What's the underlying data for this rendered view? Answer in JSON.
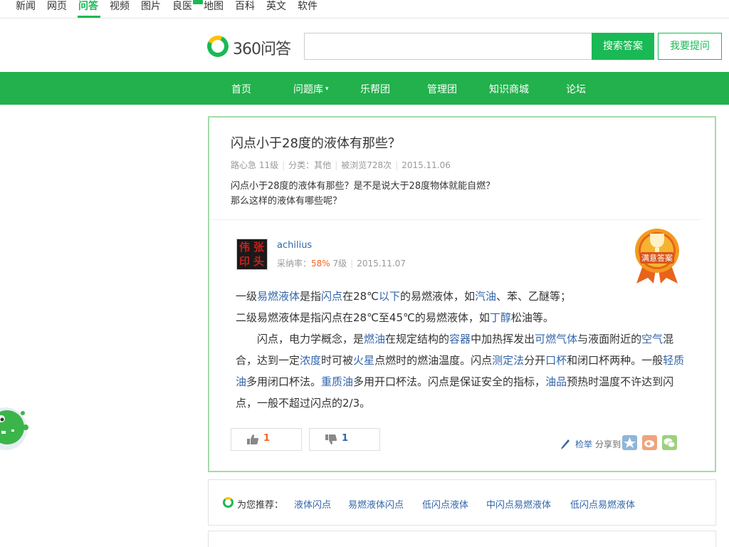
{
  "topnav": {
    "items": [
      {
        "label": "新闻"
      },
      {
        "label": "网页"
      },
      {
        "label": "问答"
      },
      {
        "label": "视频"
      },
      {
        "label": "图片"
      },
      {
        "label": "良医"
      },
      {
        "label": "地图"
      },
      {
        "label": "百科"
      },
      {
        "label": "英文"
      },
      {
        "label": "软件"
      }
    ],
    "active": "问答"
  },
  "header": {
    "logo_text": "360问答",
    "search": {
      "value": "",
      "placeholder": ""
    },
    "search_button": "搜索答案",
    "ask_button": "我要提问"
  },
  "mainnav": {
    "items": [
      {
        "label": "首页"
      },
      {
        "label": "问题库"
      },
      {
        "label": "乐帮团"
      },
      {
        "label": "管理团"
      },
      {
        "label": "知识商城"
      },
      {
        "label": "论坛"
      }
    ]
  },
  "question": {
    "title": "闪点小于28度的液体有那些？",
    "author": "路心急",
    "level": "11级",
    "category": "分类：其他",
    "views": "被浏览728次",
    "date": "2015.11.06",
    "desc_line1": "闪点小于28度的液体有那些？是不是说大于28度物体就能自燃？",
    "desc_line2": "那么这样的液体有哪些呢？"
  },
  "answer": {
    "user": "achilius",
    "accept_label": "采纳率：",
    "accept_rate": "58%",
    "level": "7级",
    "date": "2015.11.07",
    "badge_text": "满意答案",
    "line1": [
      "一级",
      "易燃液体",
      "是指",
      "闪点",
      "在28℃",
      "以下",
      "的易燃液体，如",
      "汽油",
      "、苯、乙醚等；"
    ],
    "line2": [
      "二级易燃液体是指闪点在28℃至45℃的易燃液体，如",
      "丁醇",
      "松油等。"
    ],
    "para2": [
      "闪点，电力学概念，是",
      "燃油",
      "在规定结构的",
      "容器",
      "中加热挥发出",
      "可燃气体",
      "与液面附近的",
      "空气",
      "混合，达到一定",
      "浓度",
      "时可被",
      "火星",
      "点燃时的燃油温度。闪点",
      "测定法",
      "分开",
      "口杯",
      "和闭口杯两种。一般",
      "轻质油",
      "多用闭口杯法。",
      "重质油",
      "多用开口杯法。闪点是保证安全的指标，",
      "油品",
      "预热时温度不许达到闪点，一般不超过闪点的2/3。"
    ],
    "upvotes": "1",
    "downvotes": "1",
    "report_label": "检举",
    "share_label": "分享到："
  },
  "recommend": {
    "label": "为您推荐：",
    "links": [
      "液体闪点",
      "易燃液体闪点",
      "低闪点液体",
      "中闪点易燃液体",
      "低闪点易燃液体"
    ]
  },
  "colors": {
    "brand_green": "#22b14c",
    "link_blue": "#3366aa",
    "accent_orange": "#f56524"
  }
}
